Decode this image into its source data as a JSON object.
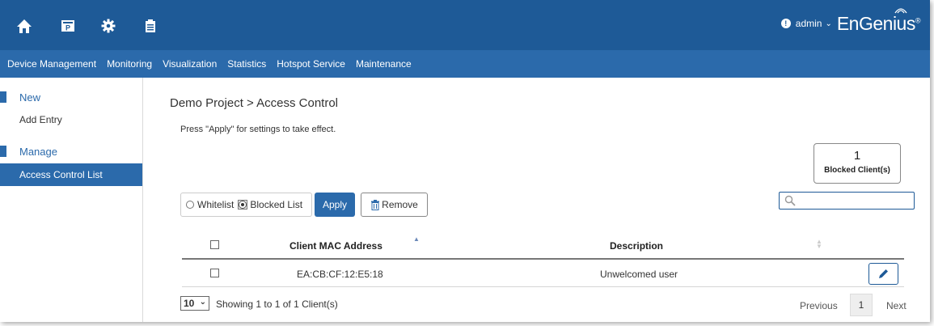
{
  "header": {
    "icons": [
      "home-icon",
      "project-icon",
      "gear-icon",
      "clipboard-icon"
    ],
    "user": "admin",
    "logo": "EnGenius",
    "logo_mark": "®"
  },
  "nav": {
    "items": [
      {
        "label": "Device Management"
      },
      {
        "label": "Monitoring"
      },
      {
        "label": "Visualization"
      },
      {
        "label": "Statistics"
      },
      {
        "label": "Hotspot Service"
      },
      {
        "label": "Maintenance"
      }
    ]
  },
  "sidebar": {
    "sections": [
      {
        "heading": "New",
        "links": [
          {
            "label": "Add Entry"
          }
        ]
      },
      {
        "heading": "Manage",
        "links": [
          {
            "label": "Access Control List"
          }
        ]
      }
    ]
  },
  "main": {
    "title": "Demo Project > Access Control",
    "hint": "Press \"Apply\" for settings to take effect.",
    "counter": {
      "value": "1",
      "label": "Blocked Client(s)"
    },
    "mode": {
      "option_1": "Whitelist",
      "option_2": "Blocked List",
      "selected": "Blocked List"
    },
    "apply_label": "Apply",
    "remove_label": "Remove",
    "search": {
      "placeholder": "",
      "value": ""
    },
    "table": {
      "columns": [
        "Client MAC Address",
        "Description"
      ],
      "rows": [
        {
          "mac": "EA:CB:CF:12:E5:18",
          "description": "Unwelcomed user"
        }
      ]
    },
    "footer": {
      "page_size": "10",
      "showing": "Showing 1 to 1 of 1 Client(s)",
      "previous": "Previous",
      "page": "1",
      "next": "Next"
    }
  },
  "colors": {
    "topbar": "#1e5a97",
    "navbar": "#2b6aab",
    "accent": "#2b6aab"
  }
}
